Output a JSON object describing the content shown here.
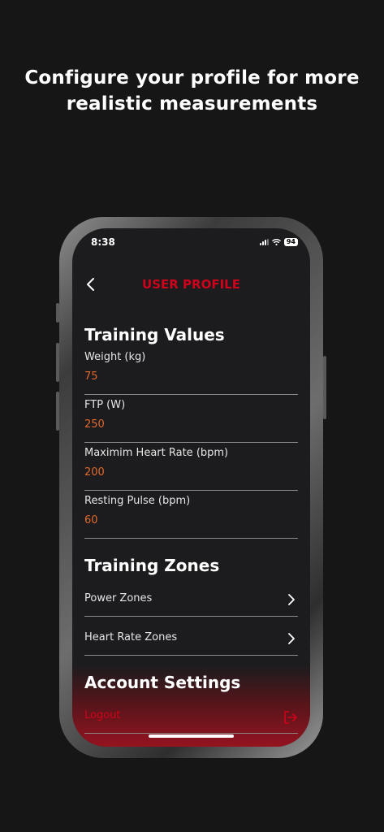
{
  "promo": {
    "headline_line1": "Configure your profile for more",
    "headline_line2": "realistic measurements"
  },
  "status_bar": {
    "time": "8:38",
    "battery": "94"
  },
  "nav": {
    "title": "USER PROFILE",
    "back_icon": "chevron-left-icon"
  },
  "training_values": {
    "title": "Training Values",
    "fields": [
      {
        "label": "Weight (kg)",
        "value": "75"
      },
      {
        "label": "FTP (W)",
        "value": "250"
      },
      {
        "label": "Maximim Heart Rate (bpm)",
        "value": "200"
      },
      {
        "label": "Resting Pulse (bpm)",
        "value": "60"
      }
    ]
  },
  "training_zones": {
    "title": "Training Zones",
    "items": [
      {
        "label": "Power Zones",
        "icon": "chevron-right-icon"
      },
      {
        "label": "Heart Rate Zones",
        "icon": "chevron-right-icon"
      }
    ]
  },
  "account_settings": {
    "title": "Account Settings",
    "logout_label": "Logout",
    "logout_icon": "logout-icon"
  },
  "colors": {
    "accent_red": "#d0021b",
    "value_orange": "#e2692a",
    "background": "#161616",
    "screen_bg": "#1c1c1e"
  }
}
